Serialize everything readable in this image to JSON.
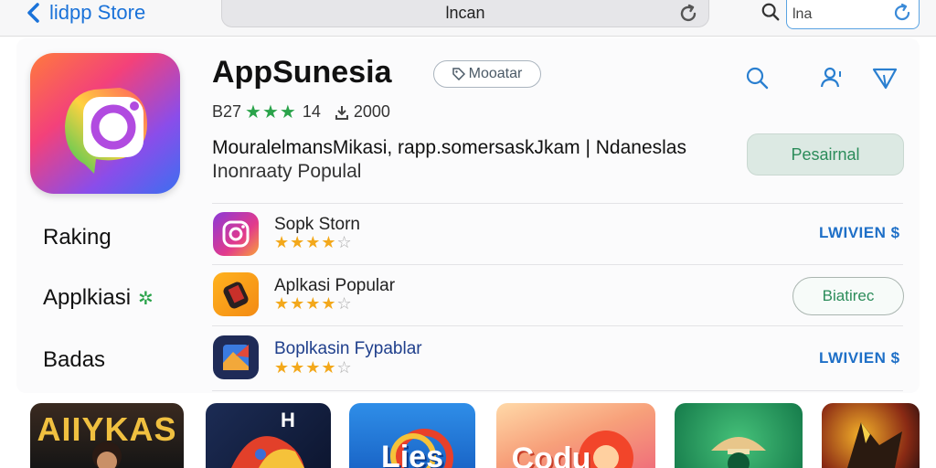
{
  "topbar": {
    "back_label": "lidpp Store",
    "address": "lncan",
    "search_value": "lna"
  },
  "app": {
    "title": "AppSunesia",
    "pill_label": "Mooatar",
    "rating_prefix": "B27",
    "rating_suffix": "14",
    "downloads": "2000",
    "description_line1": "MouralelmansМikasi, rapp.somersaskJkam | Ndaneslas",
    "description_line2": "Inonraaty Populal",
    "primary_button": "Pesairnal"
  },
  "sidebar": {
    "items": [
      {
        "label": "Raking"
      },
      {
        "label": "Applkiasi"
      },
      {
        "label": "Badas"
      }
    ]
  },
  "list": [
    {
      "name": "Sopk Storn",
      "rating": 3.5,
      "action": "LWIVIEN $"
    },
    {
      "name": "Aplkasi Popular",
      "rating": 3.5,
      "action": "Biatirec"
    },
    {
      "name": "Boplkasin Fypablar",
      "rating": 3.5,
      "action": "LWIVIEN $"
    }
  ],
  "tiles": [
    {
      "label": "AIIYKAS"
    },
    {
      "label": "H"
    },
    {
      "label": "Lies"
    },
    {
      "label": "Codu"
    },
    {
      "label": ""
    },
    {
      "label": ""
    }
  ],
  "icons": [
    "chevron-left-icon",
    "reload-icon",
    "search-icon",
    "refresh-icon",
    "tag-icon",
    "search-icon",
    "user-add-icon",
    "share-icon",
    "download-icon",
    "sparkle-icon"
  ],
  "colors": {
    "accent": "#1a72d9",
    "green": "#2aa34a",
    "star": "#f3a81b"
  }
}
